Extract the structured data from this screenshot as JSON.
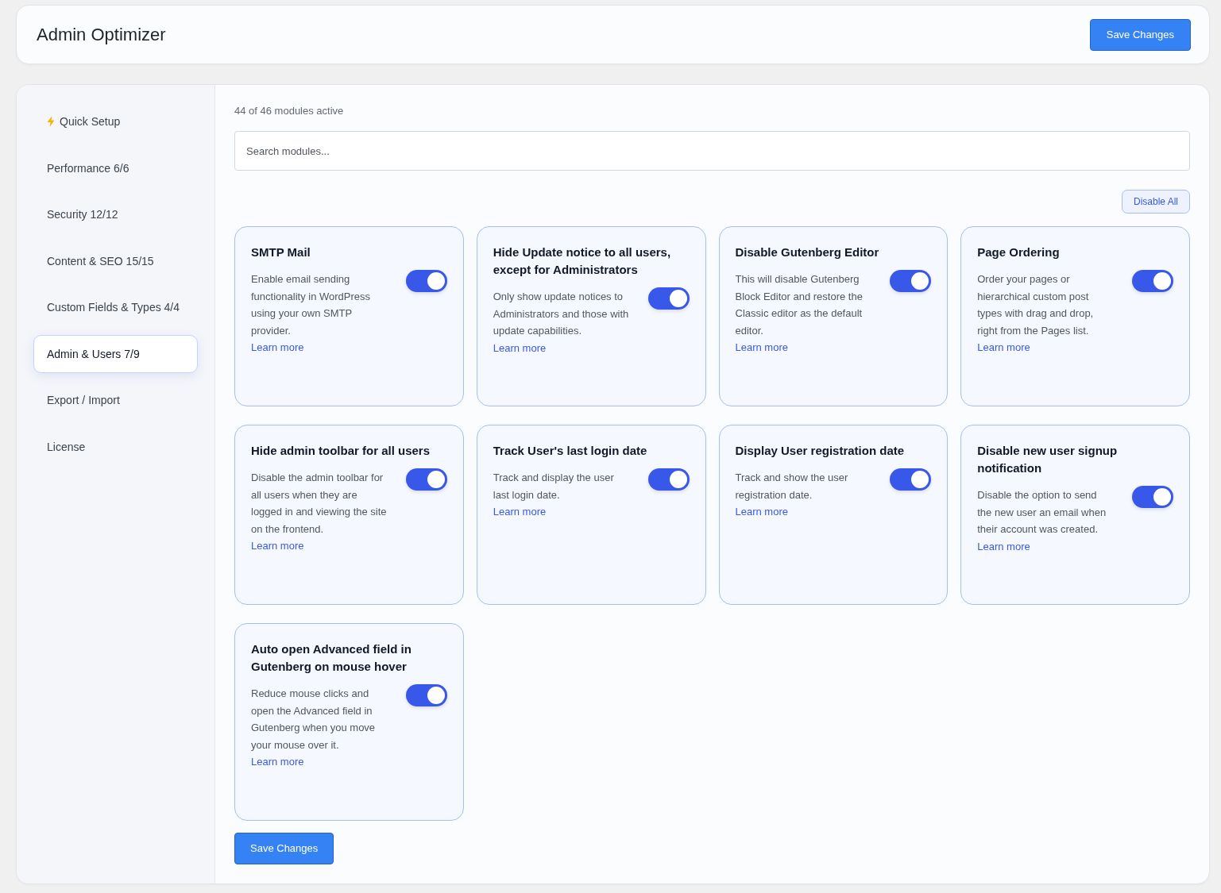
{
  "header": {
    "title": "Admin Optimizer",
    "save_button": "Save Changes"
  },
  "sidebar": {
    "items": [
      {
        "label": "Quick Setup",
        "kind": "setup",
        "selected": false
      },
      {
        "label": "Performance 6/6",
        "kind": "section",
        "selected": false
      },
      {
        "label": "Security 12/12",
        "kind": "section",
        "selected": false
      },
      {
        "label": "Content & SEO 15/15",
        "kind": "section",
        "selected": false
      },
      {
        "label": "Custom Fields & Types 4/4",
        "kind": "section",
        "selected": false
      },
      {
        "label": "Admin & Users 7/9",
        "kind": "section",
        "selected": true
      },
      {
        "label": "Export / Import",
        "kind": "section",
        "selected": false
      },
      {
        "label": "License",
        "kind": "section",
        "selected": false
      }
    ]
  },
  "content": {
    "status": "44 of 46 modules active",
    "search": {
      "placeholder": "Search modules..."
    },
    "disable_all_button": "Disable All",
    "modules": [
      {
        "title": "SMTP Mail",
        "description": "Enable email sending functionality in WordPress using your own SMTP provider.",
        "link": "Learn more",
        "on": true
      },
      {
        "title": "Hide Update notice to all users, except for Administrators",
        "description": "Only show update notices to Administrators and those with update capabilities.",
        "link": "Learn more",
        "on": true
      },
      {
        "title": "Disable Gutenberg Editor",
        "description": "This will disable Gutenberg Block Editor and restore the Classic editor as the default editor.",
        "link": "Learn more",
        "on": true
      },
      {
        "title": "Page Ordering",
        "description": "Order your pages or hierarchical custom post types with drag and drop, right from the Pages list.",
        "link": "Learn more",
        "on": true
      },
      {
        "title": "Hide admin toolbar for all users",
        "description": "Disable the admin toolbar for all users when they are logged in and viewing the site on the frontend.",
        "link": "Learn more",
        "on": true
      },
      {
        "title": "Track User's last login date",
        "description": "Track and display the user last login date.",
        "link": "Learn more",
        "on": true
      },
      {
        "title": "Display User registration date",
        "description": "Track and show the user registration date.",
        "link": "Learn more",
        "on": true
      },
      {
        "title": "Disable new user signup notification",
        "description": "Disable the option to send the new user an email when their account was created.",
        "link": "Learn more",
        "on": true
      },
      {
        "title": "Auto open Advanced field in Gutenberg on mouse hover",
        "description": "Reduce mouse clicks and open the Advanced field in Gutenberg when you move your mouse over it.",
        "link": "Learn more",
        "on": true
      }
    ],
    "save_button": "Save Changes"
  }
}
